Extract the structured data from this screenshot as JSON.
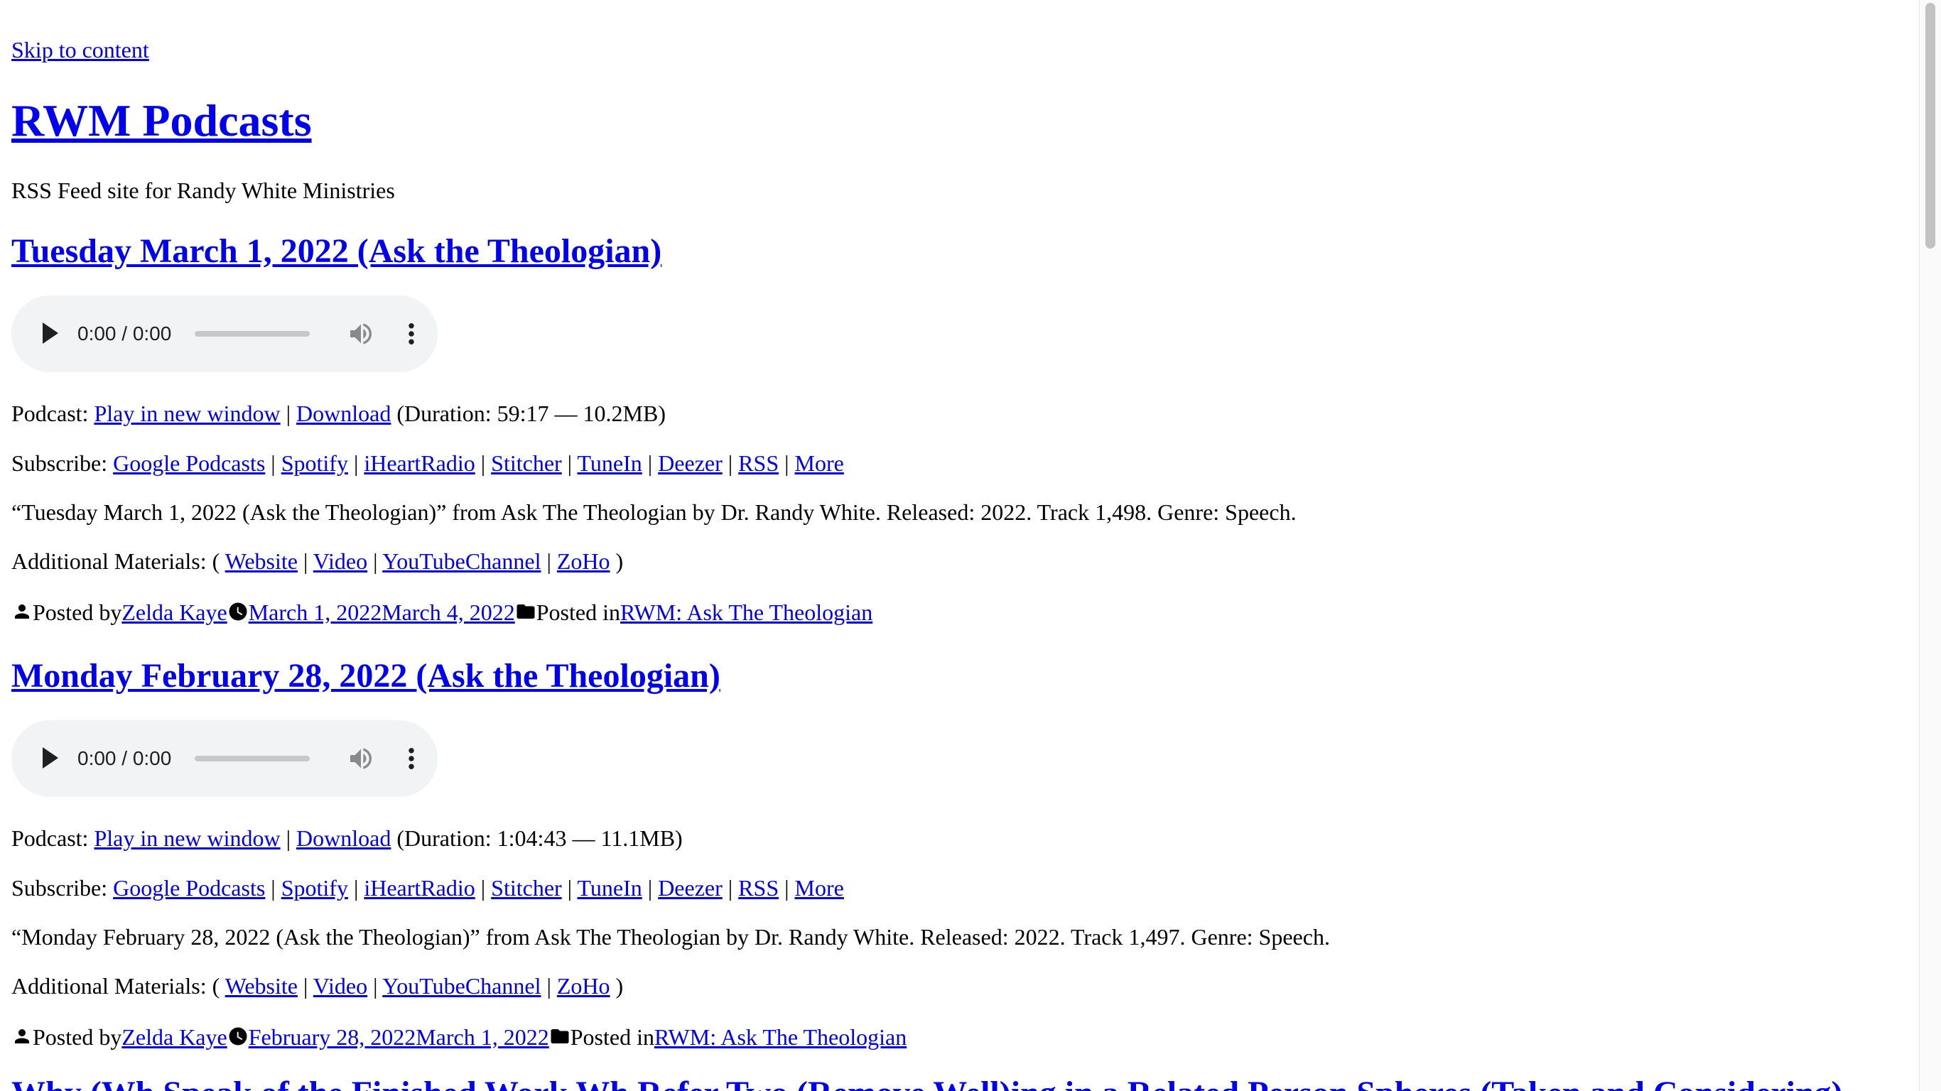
{
  "skip_link": "Skip to content",
  "site": {
    "title": "RWM Podcasts",
    "description": "RSS Feed site for Randy White Ministries"
  },
  "labels": {
    "podcast": "Podcast: ",
    "subscribe": "Subscribe: ",
    "additional": "Additional Materials: ( ",
    "additional_end": " )",
    "posted_by": "Posted by",
    "posted_in": "Posted in",
    "sep": " | "
  },
  "subscribe_links": [
    "Google Podcasts",
    "Spotify",
    "iHeartRadio",
    "Stitcher",
    "TuneIn",
    "Deezer",
    "RSS",
    "More"
  ],
  "additional_links": [
    "Website",
    "Video",
    "YouTubeChannel",
    "ZoHo"
  ],
  "posts": [
    {
      "title": "Tuesday March 1, 2022 (Ask the Theologian)",
      "audio_time": "0:00 / 0:00",
      "play_new_window": "Play in new window",
      "download": "Download",
      "duration": " (Duration: 59:17 — 10.2MB)",
      "description": "“Tuesday March 1, 2022 (Ask the Theologian)” from Ask The Theologian by Dr. Randy White. Released: 2022. Track 1,498. Genre: Speech.",
      "author": "Zelda Kaye",
      "date_published": "March 1, 2022",
      "date_updated": "March 4, 2022",
      "category": "RWM: Ask The Theologian"
    },
    {
      "title": "Monday February 28, 2022 (Ask the Theologian)",
      "audio_time": "0:00 / 0:00",
      "play_new_window": "Play in new window",
      "download": "Download",
      "duration": " (Duration: 1:04:43 — 11.1MB)",
      "description": "“Monday February 28, 2022 (Ask the Theologian)” from Ask The Theologian by Dr. Randy White. Released: 2022. Track 1,497. Genre: Speech.",
      "author": "Zelda Kaye",
      "date_published": "February 28, 2022",
      "date_updated": "March 1, 2022",
      "category": "RWM: Ask The Theologian"
    }
  ],
  "next_post_title_partial": "Why (Wh Speak of the Finished Work Wh Refer Two (Remove Well)ing in a Related Person Spheres (Taken and Considering)",
  "colors": {
    "link": "#0000ee",
    "player_bg": "#f1f3f4",
    "text": "#000000"
  },
  "icons": [
    "person-icon",
    "clock-icon",
    "folder-icon",
    "play-icon",
    "volume-icon",
    "more-vert-icon"
  ]
}
